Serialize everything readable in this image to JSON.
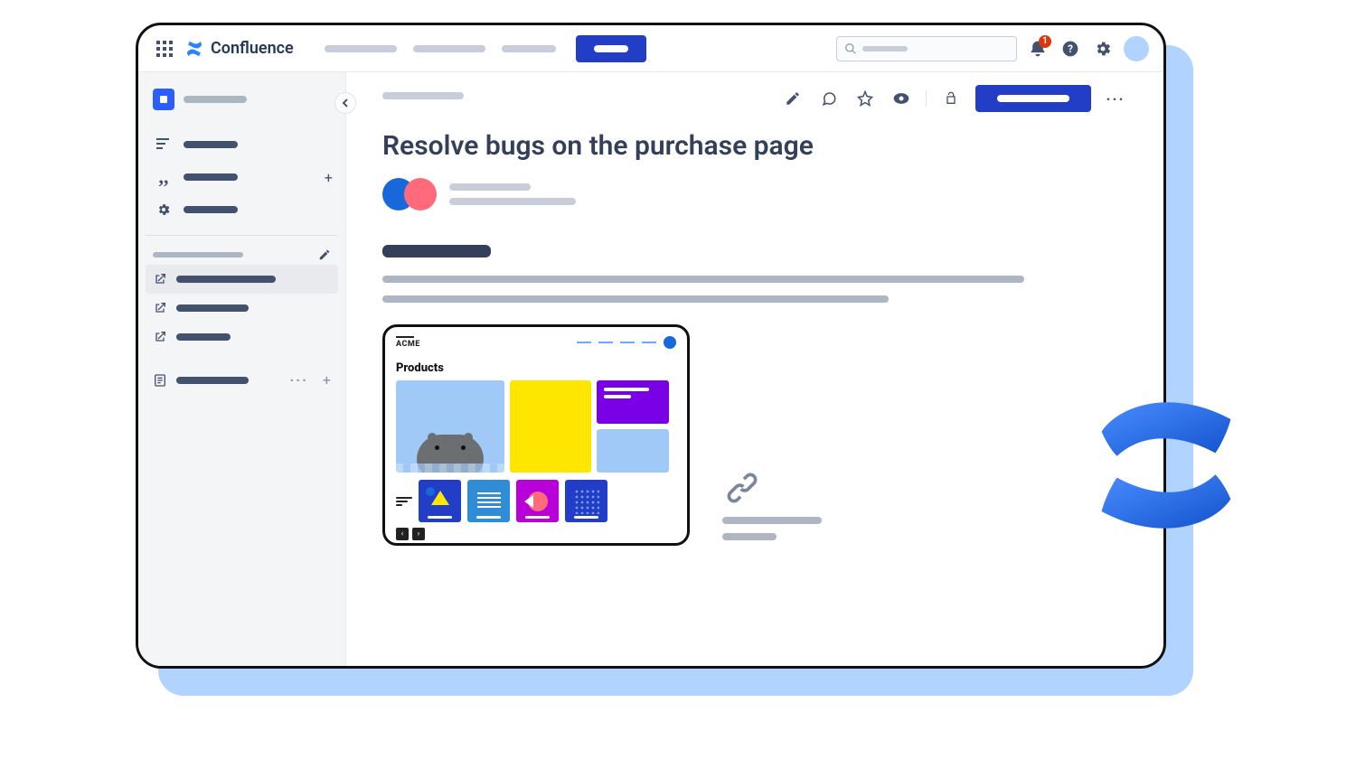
{
  "header": {
    "product_name": "Confluence",
    "notification_count": "1"
  },
  "page": {
    "title": "Resolve bugs on the purchase page"
  },
  "embedded_card": {
    "brand": "ACME",
    "section_title": "Products"
  }
}
